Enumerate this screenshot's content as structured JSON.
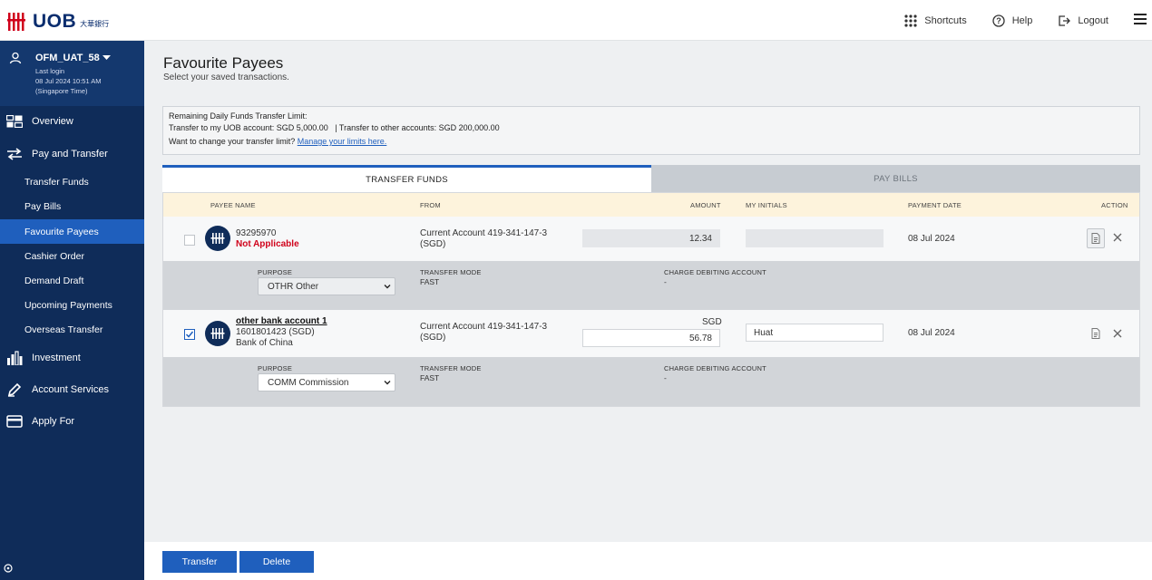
{
  "header": {
    "logo_text": "UOB",
    "logo_cn": "大華銀行",
    "shortcuts": "Shortcuts",
    "help": "Help",
    "logout": "Logout"
  },
  "user": {
    "name": "OFM_UAT_58",
    "last_login_label": "Last login",
    "last_login_time": "08 Jul 2024 10:51 AM",
    "timezone": "(Singapore Time)"
  },
  "sidebar": {
    "overview": "Overview",
    "pay_transfer": "Pay and Transfer",
    "sub_items": [
      "Transfer Funds",
      "Pay Bills",
      "Favourite Payees",
      "Cashier Order",
      "Demand Draft",
      "Upcoming Payments",
      "Overseas Transfer"
    ],
    "investment": "Investment",
    "account_services": "Account Services",
    "apply_for": "Apply For"
  },
  "page": {
    "title": "Favourite Payees",
    "subtitle": "Select your saved transactions."
  },
  "limits": {
    "heading": "Remaining Daily Funds Transfer Limit:",
    "line": "Transfer to my UOB account: SGD 5,000.00   | Transfer to other accounts: SGD 200,000.00",
    "question": "Want to change your transfer limit?",
    "link": "Manage your limits here."
  },
  "tabs": {
    "transfer_funds": "TRANSFER FUNDS",
    "pay_bills": "PAY BILLS"
  },
  "columns": {
    "payee_name": "PAYEE NAME",
    "from": "FROM",
    "amount": "AMOUNT",
    "my_initials": "MY INITIALS",
    "payment_date": "PAYMENT DATE",
    "action": "ACTION"
  },
  "detail_labels": {
    "purpose": "PURPOSE",
    "transfer_mode": "TRANSFER MODE",
    "charge_account": "CHARGE DEBITING ACCOUNT"
  },
  "rows": [
    {
      "checked": false,
      "payee_line1": "93295970",
      "payee_line2": "Not Applicable",
      "from_line1": "Current Account 419-341-147-3",
      "from_line2": "(SGD)",
      "amount": "12.34",
      "initials": "",
      "date": "08 Jul 2024",
      "purpose": "OTHR Other",
      "transfer_mode": "FAST",
      "charge_account": "-"
    },
    {
      "checked": true,
      "payee_name": "other bank account 1",
      "payee_line1": "1601801423 (SGD)",
      "payee_line2": "Bank of China",
      "from_line1": "Current Account 419-341-147-3",
      "from_line2": "(SGD)",
      "currency": "SGD",
      "amount": "56.78",
      "initials": "Huat",
      "date": "08 Jul 2024",
      "purpose": "COMM Commission",
      "transfer_mode": "FAST",
      "charge_account": "-"
    }
  ],
  "footer": {
    "transfer": "Transfer",
    "delete": "Delete"
  },
  "colors": {
    "navy": "#0f2c59",
    "accent_blue": "#1f5fbd",
    "uob_red": "#d0021b"
  }
}
